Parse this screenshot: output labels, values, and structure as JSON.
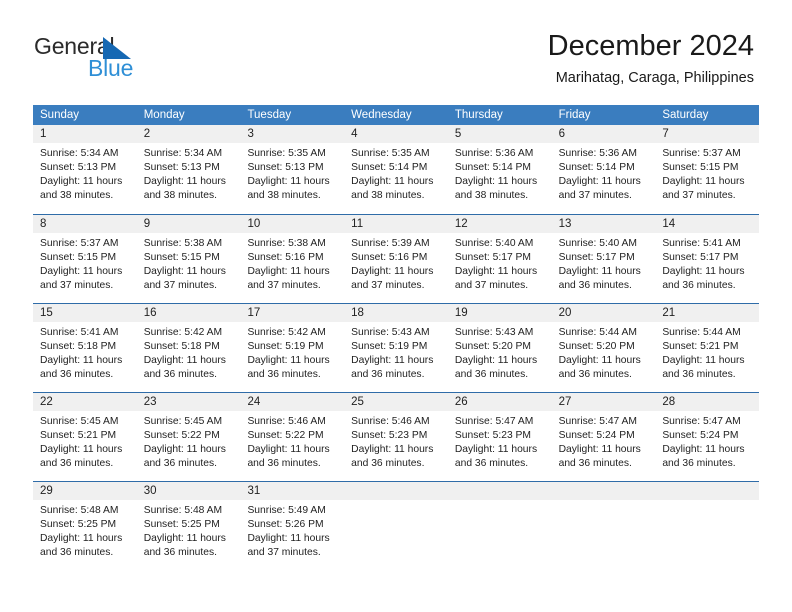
{
  "brand": {
    "name_part1": "General",
    "name_part2": "Blue",
    "accent_color": "#1668b3",
    "secondary_color": "#2f8fd6"
  },
  "header": {
    "title": "December 2024",
    "subtitle": "Marihatag, Caraga, Philippines"
  },
  "theme": {
    "header_row_bg": "#3a7dbf",
    "week_divider": "#2f6ca8",
    "day_band_bg": "#f0f0f0"
  },
  "weekdays": [
    "Sunday",
    "Monday",
    "Tuesday",
    "Wednesday",
    "Thursday",
    "Friday",
    "Saturday"
  ],
  "weeks": [
    [
      {
        "day": "1",
        "sunrise": "Sunrise: 5:34 AM",
        "sunset": "Sunset: 5:13 PM",
        "daylight_1": "Daylight: 11 hours",
        "daylight_2": "and 38 minutes."
      },
      {
        "day": "2",
        "sunrise": "Sunrise: 5:34 AM",
        "sunset": "Sunset: 5:13 PM",
        "daylight_1": "Daylight: 11 hours",
        "daylight_2": "and 38 minutes."
      },
      {
        "day": "3",
        "sunrise": "Sunrise: 5:35 AM",
        "sunset": "Sunset: 5:13 PM",
        "daylight_1": "Daylight: 11 hours",
        "daylight_2": "and 38 minutes."
      },
      {
        "day": "4",
        "sunrise": "Sunrise: 5:35 AM",
        "sunset": "Sunset: 5:14 PM",
        "daylight_1": "Daylight: 11 hours",
        "daylight_2": "and 38 minutes."
      },
      {
        "day": "5",
        "sunrise": "Sunrise: 5:36 AM",
        "sunset": "Sunset: 5:14 PM",
        "daylight_1": "Daylight: 11 hours",
        "daylight_2": "and 38 minutes."
      },
      {
        "day": "6",
        "sunrise": "Sunrise: 5:36 AM",
        "sunset": "Sunset: 5:14 PM",
        "daylight_1": "Daylight: 11 hours",
        "daylight_2": "and 37 minutes."
      },
      {
        "day": "7",
        "sunrise": "Sunrise: 5:37 AM",
        "sunset": "Sunset: 5:15 PM",
        "daylight_1": "Daylight: 11 hours",
        "daylight_2": "and 37 minutes."
      }
    ],
    [
      {
        "day": "8",
        "sunrise": "Sunrise: 5:37 AM",
        "sunset": "Sunset: 5:15 PM",
        "daylight_1": "Daylight: 11 hours",
        "daylight_2": "and 37 minutes."
      },
      {
        "day": "9",
        "sunrise": "Sunrise: 5:38 AM",
        "sunset": "Sunset: 5:15 PM",
        "daylight_1": "Daylight: 11 hours",
        "daylight_2": "and 37 minutes."
      },
      {
        "day": "10",
        "sunrise": "Sunrise: 5:38 AM",
        "sunset": "Sunset: 5:16 PM",
        "daylight_1": "Daylight: 11 hours",
        "daylight_2": "and 37 minutes."
      },
      {
        "day": "11",
        "sunrise": "Sunrise: 5:39 AM",
        "sunset": "Sunset: 5:16 PM",
        "daylight_1": "Daylight: 11 hours",
        "daylight_2": "and 37 minutes."
      },
      {
        "day": "12",
        "sunrise": "Sunrise: 5:40 AM",
        "sunset": "Sunset: 5:17 PM",
        "daylight_1": "Daylight: 11 hours",
        "daylight_2": "and 37 minutes."
      },
      {
        "day": "13",
        "sunrise": "Sunrise: 5:40 AM",
        "sunset": "Sunset: 5:17 PM",
        "daylight_1": "Daylight: 11 hours",
        "daylight_2": "and 36 minutes."
      },
      {
        "day": "14",
        "sunrise": "Sunrise: 5:41 AM",
        "sunset": "Sunset: 5:17 PM",
        "daylight_1": "Daylight: 11 hours",
        "daylight_2": "and 36 minutes."
      }
    ],
    [
      {
        "day": "15",
        "sunrise": "Sunrise: 5:41 AM",
        "sunset": "Sunset: 5:18 PM",
        "daylight_1": "Daylight: 11 hours",
        "daylight_2": "and 36 minutes."
      },
      {
        "day": "16",
        "sunrise": "Sunrise: 5:42 AM",
        "sunset": "Sunset: 5:18 PM",
        "daylight_1": "Daylight: 11 hours",
        "daylight_2": "and 36 minutes."
      },
      {
        "day": "17",
        "sunrise": "Sunrise: 5:42 AM",
        "sunset": "Sunset: 5:19 PM",
        "daylight_1": "Daylight: 11 hours",
        "daylight_2": "and 36 minutes."
      },
      {
        "day": "18",
        "sunrise": "Sunrise: 5:43 AM",
        "sunset": "Sunset: 5:19 PM",
        "daylight_1": "Daylight: 11 hours",
        "daylight_2": "and 36 minutes."
      },
      {
        "day": "19",
        "sunrise": "Sunrise: 5:43 AM",
        "sunset": "Sunset: 5:20 PM",
        "daylight_1": "Daylight: 11 hours",
        "daylight_2": "and 36 minutes."
      },
      {
        "day": "20",
        "sunrise": "Sunrise: 5:44 AM",
        "sunset": "Sunset: 5:20 PM",
        "daylight_1": "Daylight: 11 hours",
        "daylight_2": "and 36 minutes."
      },
      {
        "day": "21",
        "sunrise": "Sunrise: 5:44 AM",
        "sunset": "Sunset: 5:21 PM",
        "daylight_1": "Daylight: 11 hours",
        "daylight_2": "and 36 minutes."
      }
    ],
    [
      {
        "day": "22",
        "sunrise": "Sunrise: 5:45 AM",
        "sunset": "Sunset: 5:21 PM",
        "daylight_1": "Daylight: 11 hours",
        "daylight_2": "and 36 minutes."
      },
      {
        "day": "23",
        "sunrise": "Sunrise: 5:45 AM",
        "sunset": "Sunset: 5:22 PM",
        "daylight_1": "Daylight: 11 hours",
        "daylight_2": "and 36 minutes."
      },
      {
        "day": "24",
        "sunrise": "Sunrise: 5:46 AM",
        "sunset": "Sunset: 5:22 PM",
        "daylight_1": "Daylight: 11 hours",
        "daylight_2": "and 36 minutes."
      },
      {
        "day": "25",
        "sunrise": "Sunrise: 5:46 AM",
        "sunset": "Sunset: 5:23 PM",
        "daylight_1": "Daylight: 11 hours",
        "daylight_2": "and 36 minutes."
      },
      {
        "day": "26",
        "sunrise": "Sunrise: 5:47 AM",
        "sunset": "Sunset: 5:23 PM",
        "daylight_1": "Daylight: 11 hours",
        "daylight_2": "and 36 minutes."
      },
      {
        "day": "27",
        "sunrise": "Sunrise: 5:47 AM",
        "sunset": "Sunset: 5:24 PM",
        "daylight_1": "Daylight: 11 hours",
        "daylight_2": "and 36 minutes."
      },
      {
        "day": "28",
        "sunrise": "Sunrise: 5:47 AM",
        "sunset": "Sunset: 5:24 PM",
        "daylight_1": "Daylight: 11 hours",
        "daylight_2": "and 36 minutes."
      }
    ],
    [
      {
        "day": "29",
        "sunrise": "Sunrise: 5:48 AM",
        "sunset": "Sunset: 5:25 PM",
        "daylight_1": "Daylight: 11 hours",
        "daylight_2": "and 36 minutes."
      },
      {
        "day": "30",
        "sunrise": "Sunrise: 5:48 AM",
        "sunset": "Sunset: 5:25 PM",
        "daylight_1": "Daylight: 11 hours",
        "daylight_2": "and 36 minutes."
      },
      {
        "day": "31",
        "sunrise": "Sunrise: 5:49 AM",
        "sunset": "Sunset: 5:26 PM",
        "daylight_1": "Daylight: 11 hours",
        "daylight_2": "and 37 minutes."
      },
      {
        "day": "",
        "sunrise": "",
        "sunset": "",
        "daylight_1": "",
        "daylight_2": ""
      },
      {
        "day": "",
        "sunrise": "",
        "sunset": "",
        "daylight_1": "",
        "daylight_2": ""
      },
      {
        "day": "",
        "sunrise": "",
        "sunset": "",
        "daylight_1": "",
        "daylight_2": ""
      },
      {
        "day": "",
        "sunrise": "",
        "sunset": "",
        "daylight_1": "",
        "daylight_2": ""
      }
    ]
  ]
}
